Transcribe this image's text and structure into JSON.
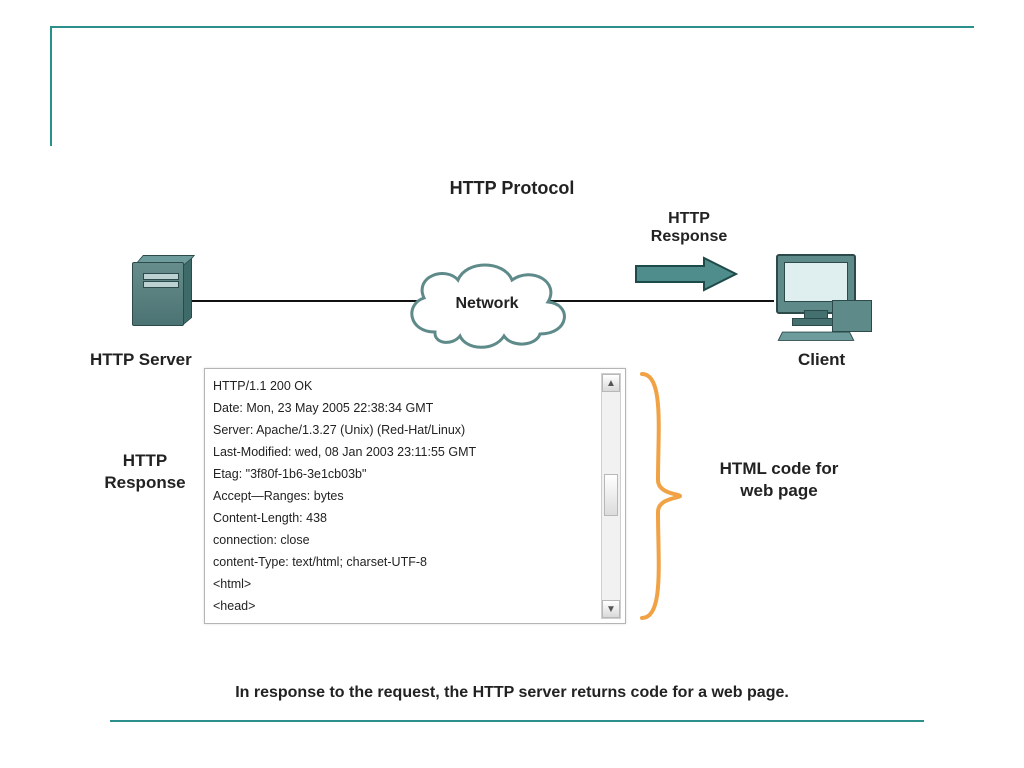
{
  "title": "HTTP Protocol",
  "cloud_label": "Network",
  "server_label": "HTTP Server",
  "client_label": "Client",
  "arrow_label": "HTTP\nResponse",
  "left_label": "HTTP\nResponse",
  "right_label": "HTML code for\nweb page",
  "caption": "In response to the request,  the HTTP server returns code for a web page.",
  "http_lines": [
    "HTTP/1.1 200 OK",
    "Date: Mon, 23 May 2005 22:38:34 GMT",
    "Server: Apache/1.3.27 (Unix) (Red-Hat/Linux)",
    "Last-Modified: wed, 08 Jan 2003 23:11:55 GMT",
    "Etag: \"3f80f-1b6-3e1cb03b\"",
    "Accept—Ranges: bytes",
    "Content-Length: 438",
    "connection: close",
    "content-Type: text/html; charset-UTF-8",
    "<html>",
    "<head>"
  ],
  "scroll_up_glyph": "▲",
  "scroll_dn_glyph": "▼",
  "colors": {
    "accent": "#2b8f8c",
    "arrow_fill": "#4f8d8c",
    "brace": "#f0a245",
    "cloud_stroke": "#5e8a8a"
  }
}
